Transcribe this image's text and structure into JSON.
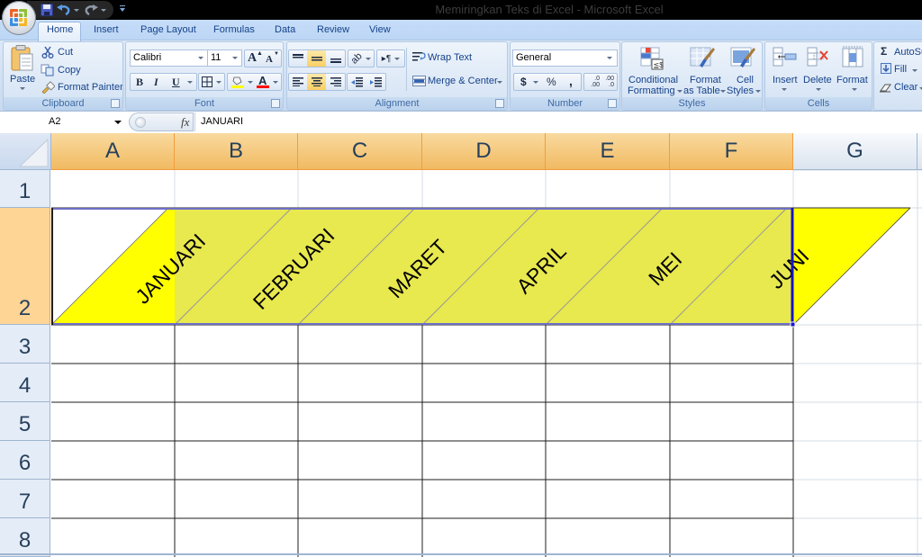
{
  "window": {
    "title": "Memiringkan Teks di Excel - Microsoft Excel"
  },
  "tabs": [
    {
      "label": "Home",
      "active": true
    },
    {
      "label": "Insert"
    },
    {
      "label": "Page Layout"
    },
    {
      "label": "Formulas"
    },
    {
      "label": "Data"
    },
    {
      "label": "Review"
    },
    {
      "label": "View"
    }
  ],
  "ribbon": {
    "clipboard": {
      "group_label": "Clipboard",
      "paste": "Paste",
      "cut": "Cut",
      "copy": "Copy",
      "format_painter": "Format Painter"
    },
    "font": {
      "group_label": "Font",
      "font_name": "Calibri",
      "font_size": "11",
      "bold": "B",
      "italic": "I",
      "underline": "U",
      "grow_font": "A",
      "shrink_font": "A",
      "fill_color": "#ffff00",
      "font_color": "#ff0000"
    },
    "alignment": {
      "group_label": "Alignment",
      "wrap_text": "Wrap Text",
      "merge_center": "Merge & Center",
      "active_vertical_align": "middle",
      "active_horizontal_align": "center"
    },
    "number": {
      "group_label": "Number",
      "format": "General",
      "currency": "$",
      "percent": "%",
      "comma": ",",
      "increase_decimal": [
        ".0",
        ".00"
      ],
      "decrease_decimal": [
        ".00",
        ".0"
      ]
    },
    "styles": {
      "group_label": "Styles",
      "conditional_formatting": [
        "Conditional",
        "Formatting"
      ],
      "format_as_table": [
        "Format",
        "as Table"
      ],
      "cell_styles": [
        "Cell",
        "Styles"
      ]
    },
    "cells": {
      "group_label": "Cells",
      "insert": "Insert",
      "delete": "Delete",
      "format": "Format"
    },
    "editing": {
      "autosum": "AutoSum",
      "fill": "Fill",
      "clear": "Clear"
    }
  },
  "formula_bar": {
    "name_box": "A2",
    "fx_label": "fx",
    "content": "JANUARI"
  },
  "grid": {
    "columns": [
      "A",
      "B",
      "C",
      "D",
      "E",
      "F",
      "G"
    ],
    "selected_columns": [
      "A",
      "B",
      "C",
      "D",
      "E",
      "F"
    ],
    "rows": [
      "1",
      "2",
      "3",
      "4",
      "5",
      "6",
      "7",
      "8"
    ],
    "selected_rows": [
      "2"
    ],
    "active_cell": "A2",
    "selection_range": "A2:F2",
    "row2_values": [
      "JANUARI",
      "FEBRUARI",
      "MARET",
      "APRIL",
      "MEI",
      "JUNI"
    ],
    "row2_text_rotation_deg": 45,
    "row2_fill_color": "#ffff00",
    "bordered_range": "A3:F8"
  }
}
